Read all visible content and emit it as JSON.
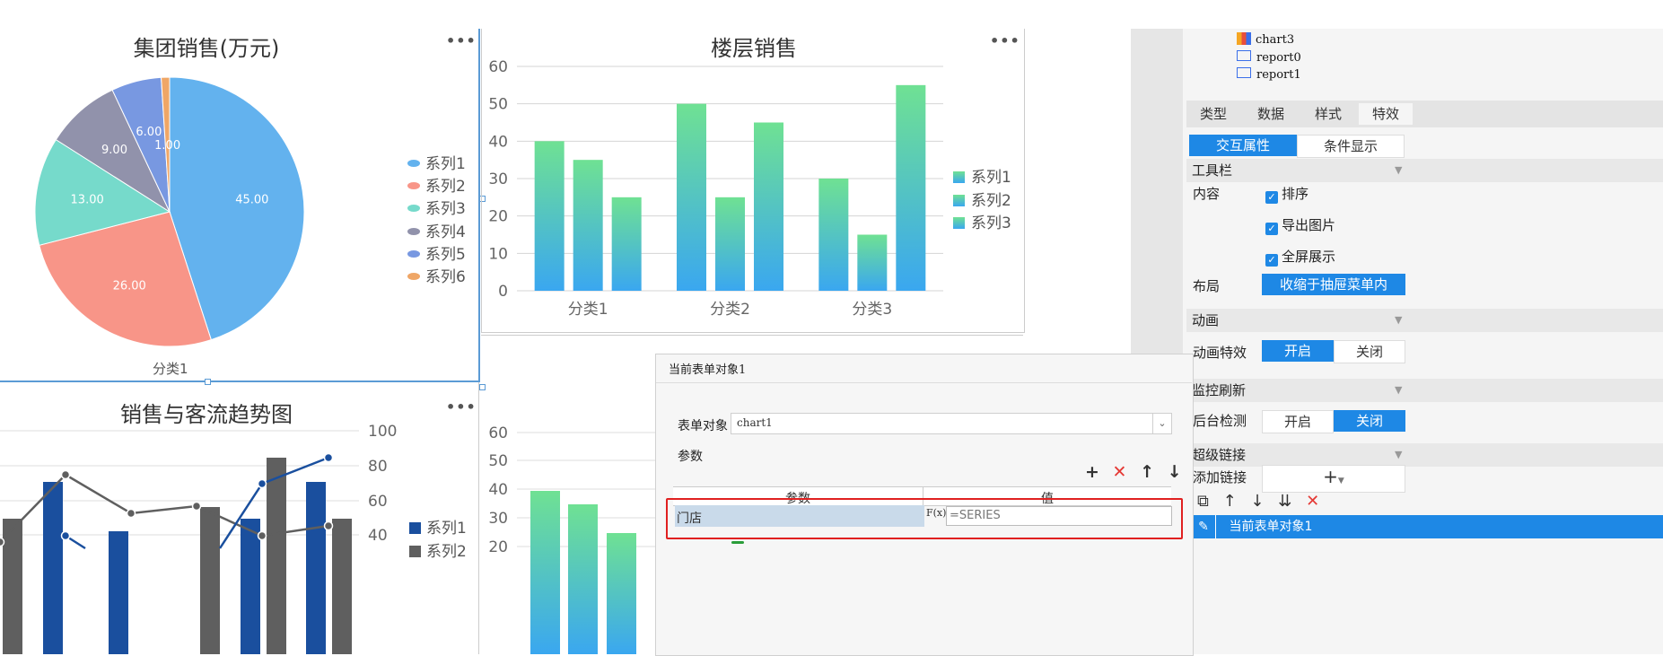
{
  "pie": {
    "title": "集团销售(万元)",
    "menu": "•••",
    "category_label": "分类1",
    "slice_labels": [
      "45.00",
      "26.00",
      "13.00",
      "9.00",
      "6.00",
      "1.00"
    ],
    "legend": [
      "系列1",
      "系列2",
      "系列3",
      "系列4",
      "系列5",
      "系列6"
    ],
    "colors": [
      "#63b2ee",
      "#f89588",
      "#76dacb",
      "#9192ab",
      "#7898e1",
      "#efa666"
    ]
  },
  "bar": {
    "title": "楼层销售",
    "menu": "•••",
    "yticks": [
      "60",
      "50",
      "40",
      "30",
      "20",
      "10",
      "0"
    ],
    "categories": [
      "分类1",
      "分类2",
      "分类3"
    ],
    "legend": [
      "系列1",
      "系列2",
      "系列3"
    ]
  },
  "combo": {
    "title": "销售与客流趋势图",
    "menu": "•••",
    "yticks": [
      "100",
      "80",
      "60",
      "40"
    ],
    "legend": [
      "系列1",
      "系列2"
    ]
  },
  "bar2": {
    "yticks": [
      "60",
      "50",
      "40",
      "30",
      "20"
    ]
  },
  "chart_data": [
    {
      "type": "pie",
      "title": "集团销售(万元)",
      "categories": [
        "分类1"
      ],
      "series": [
        {
          "name": "系列1",
          "values": [
            45
          ]
        },
        {
          "name": "系列2",
          "values": [
            26
          ]
        },
        {
          "name": "系列3",
          "values": [
            13
          ]
        },
        {
          "name": "系列4",
          "values": [
            9
          ]
        },
        {
          "name": "系列5",
          "values": [
            6
          ]
        },
        {
          "name": "系列6",
          "values": [
            1
          ]
        }
      ],
      "legend": "right"
    },
    {
      "type": "bar",
      "title": "楼层销售",
      "categories": [
        "分类1",
        "分类2",
        "分类3"
      ],
      "series": [
        {
          "name": "系列1",
          "values": [
            40,
            50,
            30
          ]
        },
        {
          "name": "系列2",
          "values": [
            35,
            25,
            15
          ]
        },
        {
          "name": "系列3",
          "values": [
            25,
            45,
            55
          ]
        }
      ],
      "ylim": [
        0,
        60
      ],
      "grid": true,
      "legend": "right"
    },
    {
      "type": "bar",
      "title": "销售与客流趋势图",
      "series": [
        {
          "name": "系列1"
        },
        {
          "name": "系列2"
        }
      ],
      "ylim_right": [
        40,
        100
      ],
      "legend": "right"
    }
  ],
  "tree": {
    "items": [
      "chart3",
      "report0",
      "report1"
    ]
  },
  "tabs": [
    "类型",
    "数据",
    "样式",
    "特效"
  ],
  "subtabs": [
    "交互属性",
    "条件显示"
  ],
  "toolbar_section": {
    "label": "工具栏",
    "content_label": "内容",
    "checks": [
      "排序",
      "导出图片",
      "全屏展示"
    ],
    "layout_label": "布局",
    "layout_value": "收缩于抽屉菜单内"
  },
  "animation": {
    "label": "动画",
    "effect_label": "动画特效",
    "on": "开启",
    "off": "关闭"
  },
  "monitor": {
    "label": "监控刷新",
    "check_label": "后台检测",
    "on": "开启",
    "off": "关闭"
  },
  "hyperlink": {
    "label": "超级链接",
    "add_label": "添加链接",
    "add_btn": "+",
    "item": "当前表单对象1"
  },
  "dialog": {
    "title": "当前表单对象1",
    "form_label": "表单对象",
    "form_value": "chart1",
    "params_label": "参数",
    "col_param": "参数",
    "col_value": "值",
    "row_param": "门店",
    "row_value": "=SERIES",
    "fx": "F(x)"
  },
  "colors": {
    "accent": "#1e88e5",
    "selection": "#c9daea",
    "red": "#e53935"
  }
}
